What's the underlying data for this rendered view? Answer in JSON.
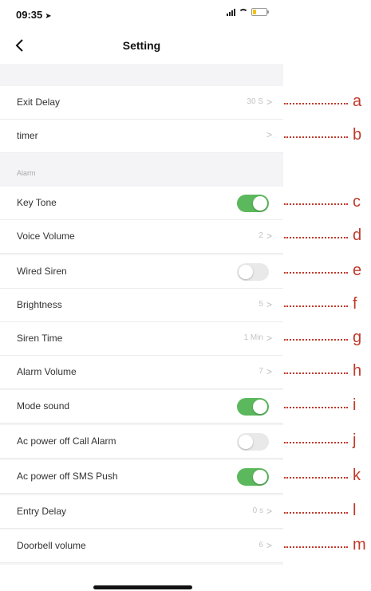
{
  "status_bar": {
    "time": "09:35",
    "location_arrow": "➤"
  },
  "nav": {
    "title": "Setting",
    "back_icon": "chevron-left-icon"
  },
  "section_alarm_label": "Alarm",
  "rows": {
    "exit_delay": {
      "label": "Exit Delay",
      "value": "30 S"
    },
    "timer": {
      "label": "timer",
      "value": ""
    },
    "key_tone": {
      "label": "Key Tone",
      "toggle": true
    },
    "voice_volume": {
      "label": "Voice Volume",
      "value": "2"
    },
    "wired_siren": {
      "label": "Wired Siren",
      "toggle": false
    },
    "brightness": {
      "label": "Brightness",
      "value": "5"
    },
    "siren_time": {
      "label": "Siren Time",
      "value": "1 Min"
    },
    "alarm_volume": {
      "label": "Alarm Volume",
      "value": "7"
    },
    "mode_sound": {
      "label": "Mode sound",
      "toggle": true
    },
    "ac_call": {
      "label": "Ac power off Call Alarm",
      "toggle": false
    },
    "ac_sms": {
      "label": "Ac power off SMS Push",
      "toggle": true
    },
    "entry_delay": {
      "label": "Entry Delay",
      "value": "0 s"
    },
    "doorbell_volume": {
      "label": "Doorbell volume",
      "value": "6"
    }
  },
  "chevron": ">",
  "annotations": [
    "a",
    "b",
    "c",
    "d",
    "e",
    "f",
    "g",
    "h",
    "i",
    "j",
    "k",
    "l",
    "m"
  ],
  "colors": {
    "toggle_on": "#5cb85c",
    "toggle_off": "#e9e9ea",
    "annotation": "#c0392b",
    "background": "#f4f4f6"
  }
}
